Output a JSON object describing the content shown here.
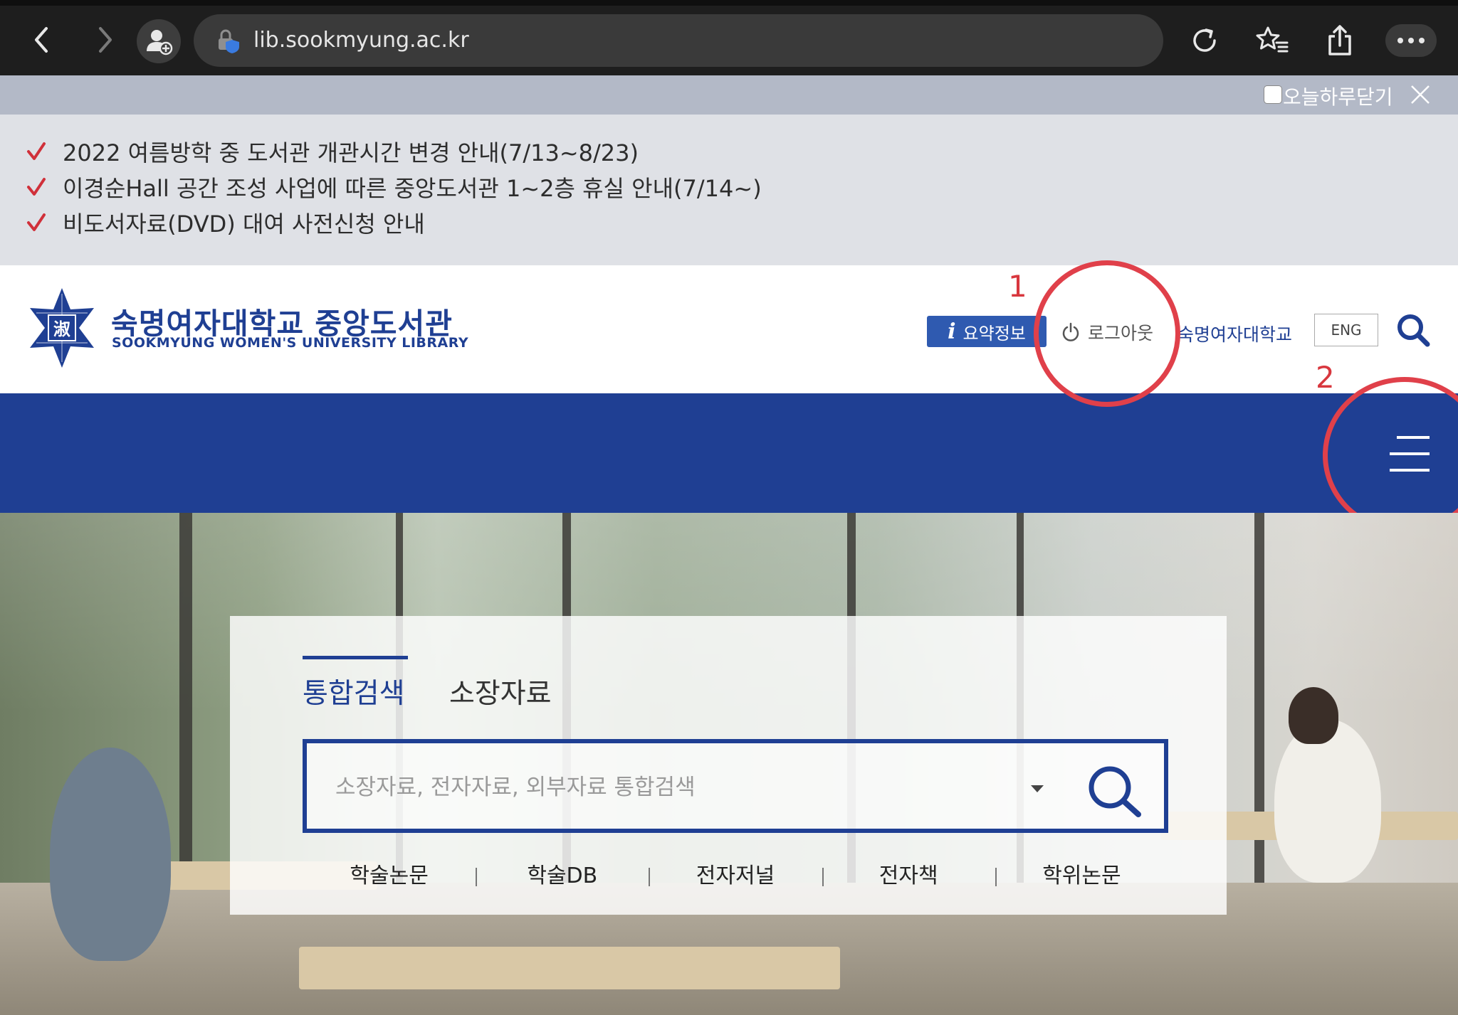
{
  "browser": {
    "url": "lib.sookmyung.ac.kr",
    "icons": [
      "back-icon",
      "forward-icon",
      "profile-add-icon",
      "lock-shield-icon",
      "reload-icon",
      "favorites-icon",
      "share-icon",
      "more-icon"
    ]
  },
  "popup": {
    "close_today_label": "오늘하루닫기",
    "notices": [
      "2022 여름방학 중 도서관 개관시간 변경 안내(7/13~8/23)",
      "이경순Hall 공간 조성 사업에 따른 중앙도서관 1~2층 휴실 안내(7/14~)",
      "비도서자료(DVD) 대여 사전신청 안내"
    ]
  },
  "header": {
    "logo_ko": "숙명여자대학교 중앙도서관",
    "logo_en": "SOOKMYUNG WOMEN'S UNIVERSITY LIBRARY",
    "summary_label": "요약정보",
    "logout_label": "로그아웃",
    "university_link": "숙명여자대학교",
    "eng_label": "ENG"
  },
  "annotations": {
    "first": "1",
    "second": "2",
    "color": "#e0404a"
  },
  "search": {
    "tabs": [
      "통합검색",
      "소장자료"
    ],
    "placeholder": "소장자료, 전자자료, 외부자료 통합검색",
    "quick_links": [
      "학술논문",
      "학술DB",
      "전자저널",
      "전자책",
      "학위논문"
    ]
  },
  "colors": {
    "brand_blue": "#1f3f93",
    "summary_blue": "#2f5ab0",
    "check_red": "#d0303a"
  }
}
